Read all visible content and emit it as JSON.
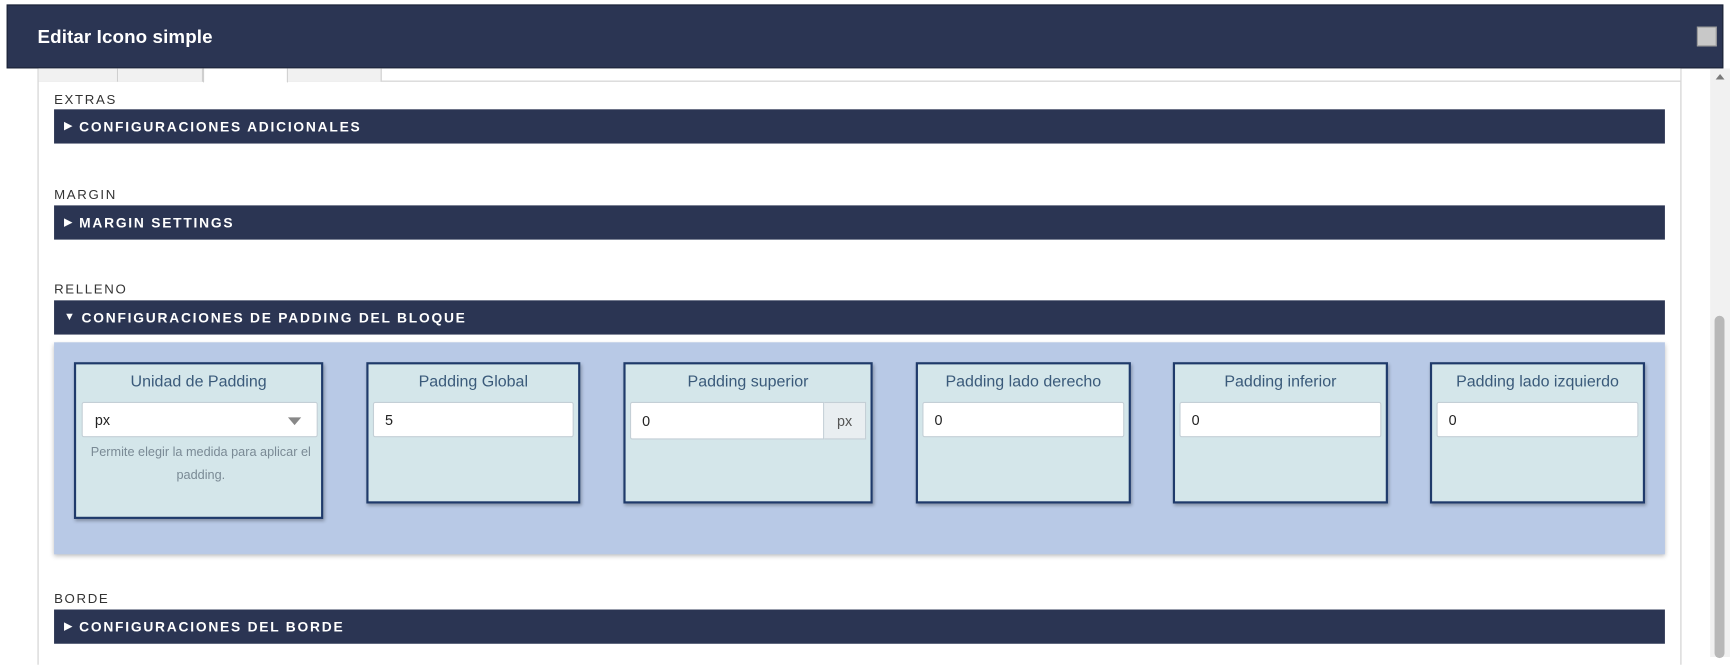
{
  "modal": {
    "title": "Editar Icono simple"
  },
  "sections": [
    {
      "label": "EXTRAS",
      "bar_title": "CONFIGURACIONES ADICIONALES",
      "expanded": false
    },
    {
      "label": "MARGIN",
      "bar_title": "MARGIN SETTINGS",
      "expanded": false
    },
    {
      "label": "RELLENO",
      "bar_title": "CONFIGURACIONES DE PADDING DEL BLOQUE",
      "expanded": true
    },
    {
      "label": "BORDE",
      "bar_title": "CONFIGURACIONES DEL BORDE",
      "expanded": false
    }
  ],
  "glyphs": {
    "collapsed": "▶",
    "expanded": "▼"
  },
  "padding": {
    "unit": {
      "label": "Unidad de Padding",
      "value": "px",
      "help": "Permite elegir la medida para aplicar el padding."
    },
    "global": {
      "label": "Padding Global",
      "value": "5"
    },
    "top": {
      "label": "Padding superior",
      "value": "0",
      "addon": "px"
    },
    "right": {
      "label": "Padding lado derecho",
      "value": "0"
    },
    "bottom": {
      "label": "Padding inferior",
      "value": "0"
    },
    "left": {
      "label": "Padding lado izquierdo",
      "value": "0"
    }
  },
  "colors": {
    "header": "#2b3553",
    "panel_bg": "#b8c9e6",
    "card_bg": "#d4e6ea",
    "card_border": "#1f3a6b"
  }
}
